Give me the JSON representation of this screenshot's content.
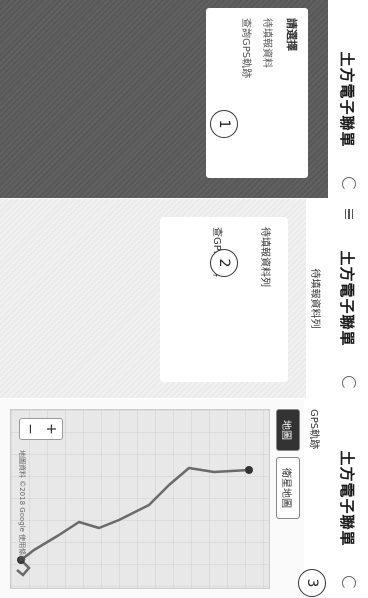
{
  "app": {
    "title": "土方電子聯單"
  },
  "panel1": {
    "menu_title": "請選擇",
    "menu_items": [
      "待填報資料",
      "查詢GPS軌跡"
    ],
    "step": "1"
  },
  "panel2": {
    "header": "待填報資料列",
    "card_line1": "待填報資料列",
    "card_line2": "查GPS資料",
    "step": "2"
  },
  "panel3": {
    "subtitle": "待填報資料列",
    "gps_title": "GPS軌跡",
    "tabs": [
      "地圖",
      "衛星地圖"
    ],
    "zoom_in": "+",
    "zoom_out": "−",
    "map_footer": "地圖資料 ©2018 Google 使用條款",
    "step": "3"
  }
}
